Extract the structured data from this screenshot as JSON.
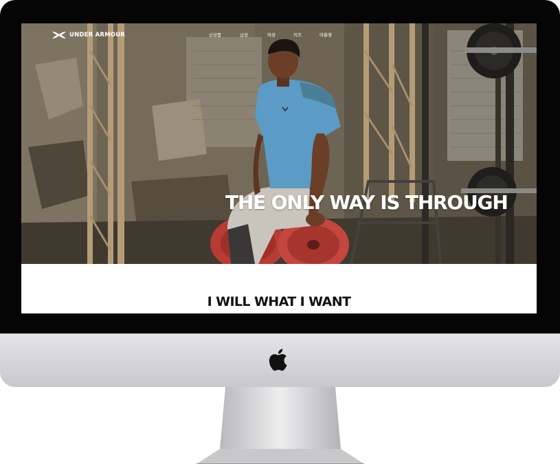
{
  "brand": {
    "name": "UNDER ARMOUR",
    "logo_icon": "under-armour-logo-icon"
  },
  "nav": {
    "items": [
      {
        "label": "신상품"
      },
      {
        "label": "남성"
      },
      {
        "label": "여성"
      },
      {
        "label": "키즈"
      },
      {
        "label": "아울렛"
      }
    ]
  },
  "hero": {
    "headline": "THE ONLY WAY IS THROUGH"
  },
  "section": {
    "tagline": "I WILL WHAT I WANT"
  },
  "device": {
    "logo_icon": "apple-logo-icon"
  },
  "colors": {
    "bezel": "#050505",
    "shirt": "#5b9bc5",
    "plate": "#c4463e",
    "accent_white": "#ffffff"
  }
}
